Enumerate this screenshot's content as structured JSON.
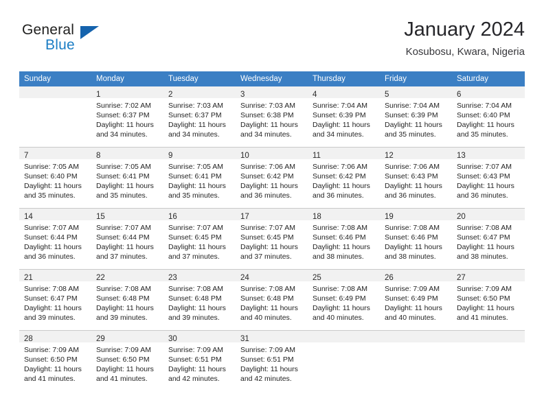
{
  "brand": {
    "line1": "General",
    "line2": "Blue",
    "logo_icon": "triangle-logo-icon"
  },
  "header": {
    "title": "January 2024",
    "subtitle": "Kosubosu, Kwara, Nigeria"
  },
  "colors": {
    "header_blue": "#3b7fc4",
    "brand_blue": "#1b7dc4",
    "logo_blue": "#1563ad",
    "daynum_band": "#f1f1f1",
    "separator": "#c9c9c9"
  },
  "calendar": {
    "weekday_headers": [
      "Sunday",
      "Monday",
      "Tuesday",
      "Wednesday",
      "Thursday",
      "Friday",
      "Saturday"
    ],
    "weeks": [
      [
        {
          "day": "",
          "sunrise": "",
          "sunset": "",
          "daylight_line1": "",
          "daylight_line2": ""
        },
        {
          "day": "1",
          "sunrise": "Sunrise: 7:02 AM",
          "sunset": "Sunset: 6:37 PM",
          "daylight_line1": "Daylight: 11 hours",
          "daylight_line2": "and 34 minutes."
        },
        {
          "day": "2",
          "sunrise": "Sunrise: 7:03 AM",
          "sunset": "Sunset: 6:37 PM",
          "daylight_line1": "Daylight: 11 hours",
          "daylight_line2": "and 34 minutes."
        },
        {
          "day": "3",
          "sunrise": "Sunrise: 7:03 AM",
          "sunset": "Sunset: 6:38 PM",
          "daylight_line1": "Daylight: 11 hours",
          "daylight_line2": "and 34 minutes."
        },
        {
          "day": "4",
          "sunrise": "Sunrise: 7:04 AM",
          "sunset": "Sunset: 6:39 PM",
          "daylight_line1": "Daylight: 11 hours",
          "daylight_line2": "and 34 minutes."
        },
        {
          "day": "5",
          "sunrise": "Sunrise: 7:04 AM",
          "sunset": "Sunset: 6:39 PM",
          "daylight_line1": "Daylight: 11 hours",
          "daylight_line2": "and 35 minutes."
        },
        {
          "day": "6",
          "sunrise": "Sunrise: 7:04 AM",
          "sunset": "Sunset: 6:40 PM",
          "daylight_line1": "Daylight: 11 hours",
          "daylight_line2": "and 35 minutes."
        }
      ],
      [
        {
          "day": "7",
          "sunrise": "Sunrise: 7:05 AM",
          "sunset": "Sunset: 6:40 PM",
          "daylight_line1": "Daylight: 11 hours",
          "daylight_line2": "and 35 minutes."
        },
        {
          "day": "8",
          "sunrise": "Sunrise: 7:05 AM",
          "sunset": "Sunset: 6:41 PM",
          "daylight_line1": "Daylight: 11 hours",
          "daylight_line2": "and 35 minutes."
        },
        {
          "day": "9",
          "sunrise": "Sunrise: 7:05 AM",
          "sunset": "Sunset: 6:41 PM",
          "daylight_line1": "Daylight: 11 hours",
          "daylight_line2": "and 35 minutes."
        },
        {
          "day": "10",
          "sunrise": "Sunrise: 7:06 AM",
          "sunset": "Sunset: 6:42 PM",
          "daylight_line1": "Daylight: 11 hours",
          "daylight_line2": "and 36 minutes."
        },
        {
          "day": "11",
          "sunrise": "Sunrise: 7:06 AM",
          "sunset": "Sunset: 6:42 PM",
          "daylight_line1": "Daylight: 11 hours",
          "daylight_line2": "and 36 minutes."
        },
        {
          "day": "12",
          "sunrise": "Sunrise: 7:06 AM",
          "sunset": "Sunset: 6:43 PM",
          "daylight_line1": "Daylight: 11 hours",
          "daylight_line2": "and 36 minutes."
        },
        {
          "day": "13",
          "sunrise": "Sunrise: 7:07 AM",
          "sunset": "Sunset: 6:43 PM",
          "daylight_line1": "Daylight: 11 hours",
          "daylight_line2": "and 36 minutes."
        }
      ],
      [
        {
          "day": "14",
          "sunrise": "Sunrise: 7:07 AM",
          "sunset": "Sunset: 6:44 PM",
          "daylight_line1": "Daylight: 11 hours",
          "daylight_line2": "and 36 minutes."
        },
        {
          "day": "15",
          "sunrise": "Sunrise: 7:07 AM",
          "sunset": "Sunset: 6:44 PM",
          "daylight_line1": "Daylight: 11 hours",
          "daylight_line2": "and 37 minutes."
        },
        {
          "day": "16",
          "sunrise": "Sunrise: 7:07 AM",
          "sunset": "Sunset: 6:45 PM",
          "daylight_line1": "Daylight: 11 hours",
          "daylight_line2": "and 37 minutes."
        },
        {
          "day": "17",
          "sunrise": "Sunrise: 7:07 AM",
          "sunset": "Sunset: 6:45 PM",
          "daylight_line1": "Daylight: 11 hours",
          "daylight_line2": "and 37 minutes."
        },
        {
          "day": "18",
          "sunrise": "Sunrise: 7:08 AM",
          "sunset": "Sunset: 6:46 PM",
          "daylight_line1": "Daylight: 11 hours",
          "daylight_line2": "and 38 minutes."
        },
        {
          "day": "19",
          "sunrise": "Sunrise: 7:08 AM",
          "sunset": "Sunset: 6:46 PM",
          "daylight_line1": "Daylight: 11 hours",
          "daylight_line2": "and 38 minutes."
        },
        {
          "day": "20",
          "sunrise": "Sunrise: 7:08 AM",
          "sunset": "Sunset: 6:47 PM",
          "daylight_line1": "Daylight: 11 hours",
          "daylight_line2": "and 38 minutes."
        }
      ],
      [
        {
          "day": "21",
          "sunrise": "Sunrise: 7:08 AM",
          "sunset": "Sunset: 6:47 PM",
          "daylight_line1": "Daylight: 11 hours",
          "daylight_line2": "and 39 minutes."
        },
        {
          "day": "22",
          "sunrise": "Sunrise: 7:08 AM",
          "sunset": "Sunset: 6:48 PM",
          "daylight_line1": "Daylight: 11 hours",
          "daylight_line2": "and 39 minutes."
        },
        {
          "day": "23",
          "sunrise": "Sunrise: 7:08 AM",
          "sunset": "Sunset: 6:48 PM",
          "daylight_line1": "Daylight: 11 hours",
          "daylight_line2": "and 39 minutes."
        },
        {
          "day": "24",
          "sunrise": "Sunrise: 7:08 AM",
          "sunset": "Sunset: 6:48 PM",
          "daylight_line1": "Daylight: 11 hours",
          "daylight_line2": "and 40 minutes."
        },
        {
          "day": "25",
          "sunrise": "Sunrise: 7:08 AM",
          "sunset": "Sunset: 6:49 PM",
          "daylight_line1": "Daylight: 11 hours",
          "daylight_line2": "and 40 minutes."
        },
        {
          "day": "26",
          "sunrise": "Sunrise: 7:09 AM",
          "sunset": "Sunset: 6:49 PM",
          "daylight_line1": "Daylight: 11 hours",
          "daylight_line2": "and 40 minutes."
        },
        {
          "day": "27",
          "sunrise": "Sunrise: 7:09 AM",
          "sunset": "Sunset: 6:50 PM",
          "daylight_line1": "Daylight: 11 hours",
          "daylight_line2": "and 41 minutes."
        }
      ],
      [
        {
          "day": "28",
          "sunrise": "Sunrise: 7:09 AM",
          "sunset": "Sunset: 6:50 PM",
          "daylight_line1": "Daylight: 11 hours",
          "daylight_line2": "and 41 minutes."
        },
        {
          "day": "29",
          "sunrise": "Sunrise: 7:09 AM",
          "sunset": "Sunset: 6:50 PM",
          "daylight_line1": "Daylight: 11 hours",
          "daylight_line2": "and 41 minutes."
        },
        {
          "day": "30",
          "sunrise": "Sunrise: 7:09 AM",
          "sunset": "Sunset: 6:51 PM",
          "daylight_line1": "Daylight: 11 hours",
          "daylight_line2": "and 42 minutes."
        },
        {
          "day": "31",
          "sunrise": "Sunrise: 7:09 AM",
          "sunset": "Sunset: 6:51 PM",
          "daylight_line1": "Daylight: 11 hours",
          "daylight_line2": "and 42 minutes."
        },
        {
          "day": "",
          "sunrise": "",
          "sunset": "",
          "daylight_line1": "",
          "daylight_line2": ""
        },
        {
          "day": "",
          "sunrise": "",
          "sunset": "",
          "daylight_line1": "",
          "daylight_line2": ""
        },
        {
          "day": "",
          "sunrise": "",
          "sunset": "",
          "daylight_line1": "",
          "daylight_line2": ""
        }
      ]
    ]
  }
}
